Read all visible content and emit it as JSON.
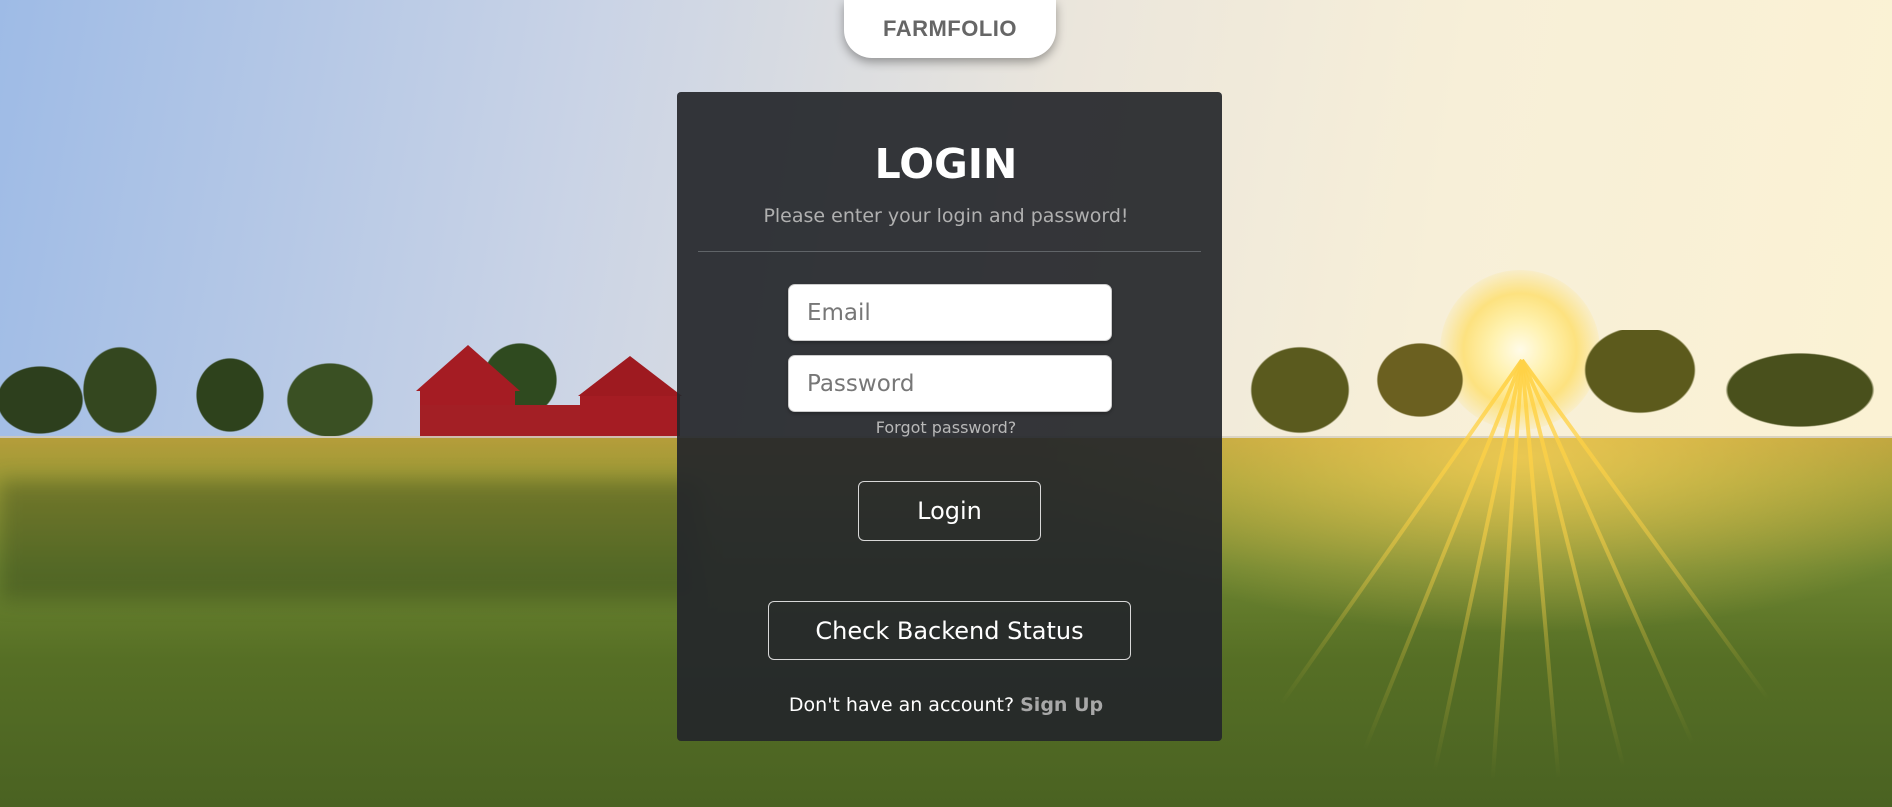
{
  "brand": {
    "name": "FARMFOLIO"
  },
  "login": {
    "title": "LOGIN",
    "subtitle": "Please enter your login and password!",
    "email_placeholder": "Email",
    "password_placeholder": "Password",
    "forgot_label": "Forgot password?",
    "login_button": "Login",
    "status_button": "Check Backend Status",
    "signup_prompt": "Don't have an account?",
    "signup_link": "Sign Up"
  },
  "colors": {
    "card_background": "#24262a",
    "brand_text": "#666666",
    "link_muted": "#a8a8a8"
  }
}
